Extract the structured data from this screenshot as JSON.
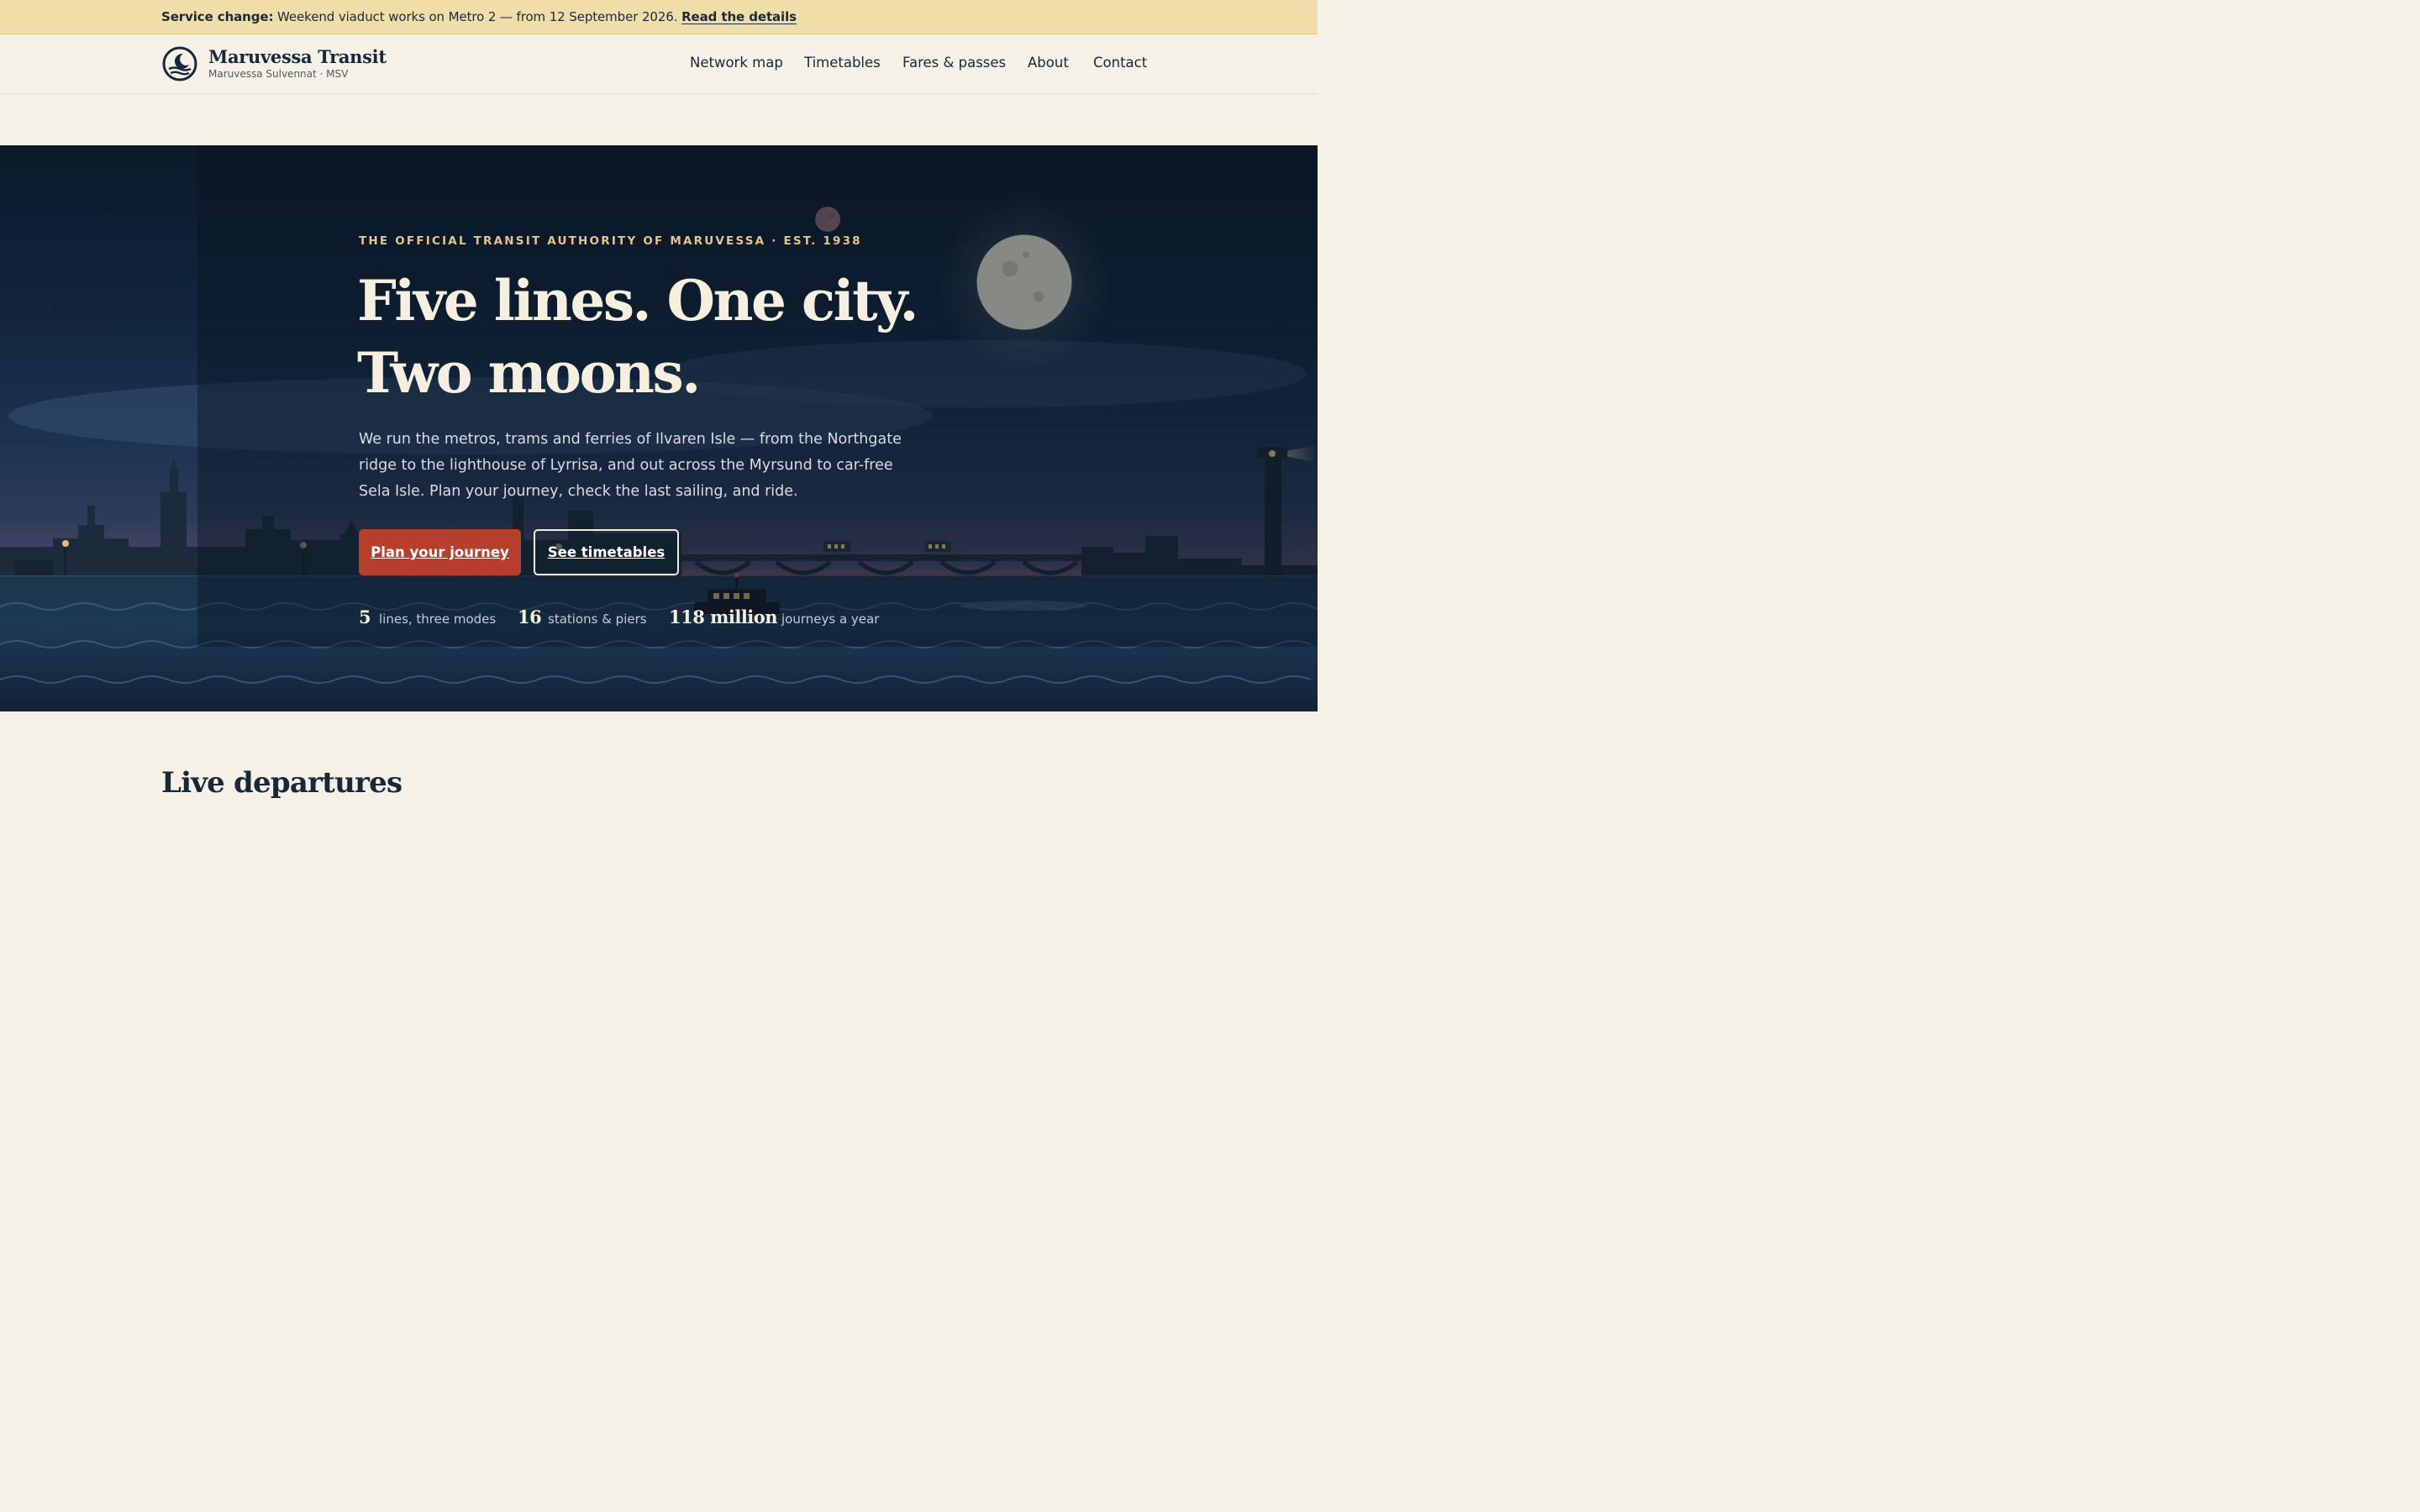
{
  "banner": {
    "prefix": "Service change:",
    "message": "Weekend viaduct works on Metro 2 — from 12 September 2026.",
    "link": "Read the details"
  },
  "header": {
    "brand_name": "Maruvessa Transit",
    "brand_sub": "Maruvessa Sulvennat · MSV",
    "nav": [
      "Network map",
      "Timetables",
      "Fares & passes",
      "About",
      "Contact"
    ]
  },
  "hero": {
    "eyebrow": "THE OFFICIAL TRANSIT AUTHORITY OF MARUVESSA · EST. 1938",
    "headline_line1": "Five lines. One city.",
    "headline_line2": "Two moons.",
    "intro": "We run the metros, trams and ferries of Ilvaren Isle — from the Northgate ridge to the lighthouse of Lyrrisa, and out across the Myrsund to car-free Sela Isle. Plan your journey, check the last sailing, and ride.",
    "primary_cta": "Plan your journey",
    "secondary_cta": "See timetables",
    "stats": [
      {
        "value": "5",
        "label": "lines, three modes"
      },
      {
        "value": "16",
        "label": "stations & piers"
      },
      {
        "value": "118 million",
        "label": "journeys a year"
      }
    ]
  },
  "departures": {
    "title": "Live departures"
  },
  "colors": {
    "accent": "#b73e2c",
    "banner": "#f0deaa",
    "ink": "#16283a",
    "eyebrow": "#e7c48a",
    "paper": "#f5f1e6"
  }
}
